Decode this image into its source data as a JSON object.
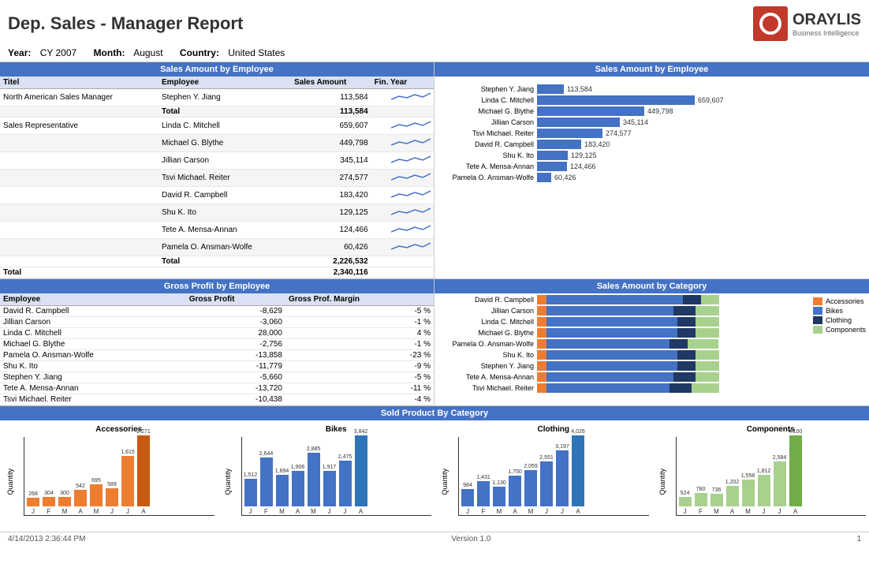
{
  "header": {
    "title": "Dep. Sales - Manager Report",
    "year_label": "Year:",
    "year_val": "CY 2007",
    "month_label": "Month:",
    "month_val": "August",
    "country_label": "Country:",
    "country_val": "United States"
  },
  "logo": {
    "name": "ORAYLIS",
    "sub": "Business Intelligence"
  },
  "sales_by_employee_table": {
    "title": "Sales Amount by Employee",
    "cols": [
      "Titel",
      "Employee",
      "Sales Amount",
      "Fin. Year"
    ],
    "rows": [
      {
        "titel": "North American Sales Manager",
        "employee": "Stephen Y. Jiang",
        "amount": "113,584",
        "fin_year": "~"
      },
      {
        "titel": "",
        "employee": "Total",
        "amount": "113,584",
        "fin_year": ""
      },
      {
        "titel": "Sales Representative",
        "employee": "Linda C. Mitchell",
        "amount": "659,607",
        "fin_year": "~"
      },
      {
        "titel": "",
        "employee": "Michael G. Blythe",
        "amount": "449,798",
        "fin_year": "~"
      },
      {
        "titel": "",
        "employee": "Jillian Carson",
        "amount": "345,114",
        "fin_year": "~"
      },
      {
        "titel": "",
        "employee": "Tsvi Michael. Reiter",
        "amount": "274,577",
        "fin_year": "~"
      },
      {
        "titel": "",
        "employee": "David R. Campbell",
        "amount": "183,420",
        "fin_year": "~"
      },
      {
        "titel": "",
        "employee": "Shu K. Ito",
        "amount": "129,125",
        "fin_year": "~"
      },
      {
        "titel": "",
        "employee": "Tete A. Mensa-Annan",
        "amount": "124,466",
        "fin_year": "~"
      },
      {
        "titel": "",
        "employee": "Pamela O. Ansman-Wolfe",
        "amount": "60,426",
        "fin_year": "~"
      },
      {
        "titel": "",
        "employee": "Total",
        "amount": "2,226,532",
        "fin_year": ""
      },
      {
        "titel": "Total",
        "employee": "",
        "amount": "2,340,116",
        "fin_year": ""
      }
    ]
  },
  "sales_bar_chart": {
    "title": "Sales Amount by Employee",
    "bars": [
      {
        "label": "Stephen Y. Jiang",
        "value": 113584,
        "display": "113,584"
      },
      {
        "label": "Linda C. Mitchell",
        "value": 659607,
        "display": "659,607"
      },
      {
        "label": "Michael G. Blythe",
        "value": 449798,
        "display": "449,798"
      },
      {
        "label": "Jillian Carson",
        "value": 345114,
        "display": "345,114"
      },
      {
        "label": "Tsvi Michael. Reiter",
        "value": 274577,
        "display": "274,577"
      },
      {
        "label": "David R. Campbell",
        "value": 183420,
        "display": "183,420"
      },
      {
        "label": "Shu K. Ito",
        "value": 129125,
        "display": "129,125"
      },
      {
        "label": "Tete A. Mensa-Annan",
        "value": 124466,
        "display": "124,466"
      },
      {
        "label": "Pamela O. Ansman-Wolfe",
        "value": 60426,
        "display": "60,426"
      }
    ],
    "max": 659607
  },
  "gross_profit_table": {
    "title": "Gross Profit by Employee",
    "cols": [
      "Employee",
      "Gross Profit",
      "Gross Prof. Margin"
    ],
    "rows": [
      {
        "employee": "David R. Campbell",
        "profit": "-8,629",
        "margin": "-5 %"
      },
      {
        "employee": "Jillian Carson",
        "profit": "-3,060",
        "margin": "-1 %"
      },
      {
        "employee": "Linda C. Mitchell",
        "profit": "28,000",
        "margin": "4 %"
      },
      {
        "employee": "Michael G. Blythe",
        "profit": "-2,756",
        "margin": "-1 %"
      },
      {
        "employee": "Pamela O. Ansman-Wolfe",
        "profit": "-13,858",
        "margin": "-23 %"
      },
      {
        "employee": "Shu K. Ito",
        "profit": "-11,779",
        "margin": "-9 %"
      },
      {
        "employee": "Stephen Y. Jiang",
        "profit": "-5,660",
        "margin": "-5 %"
      },
      {
        "employee": "Tete A. Mensa-Annan",
        "profit": "-13,720",
        "margin": "-11 %"
      },
      {
        "employee": "Tsvi Michael. Reiter",
        "profit": "-10,438",
        "margin": "-4 %"
      }
    ]
  },
  "sales_by_category_chart": {
    "title": "Sales Amount by Category",
    "legend": [
      "Accessories",
      "Bikes",
      "Clothing",
      "Components"
    ],
    "bars": [
      {
        "label": "David R. Campbell",
        "accessories": 5,
        "bikes": 75,
        "clothing": 10,
        "components": 10
      },
      {
        "label": "Jillian Carson",
        "accessories": 5,
        "bikes": 70,
        "clothing": 12,
        "components": 13
      },
      {
        "label": "Linda C. Mitchell",
        "accessories": 5,
        "bikes": 72,
        "clothing": 10,
        "components": 13
      },
      {
        "label": "Michael G. Blythe",
        "accessories": 5,
        "bikes": 72,
        "clothing": 10,
        "components": 13
      },
      {
        "label": "Pamela O. Ansman-Wolfe",
        "accessories": 5,
        "bikes": 68,
        "clothing": 10,
        "components": 17
      },
      {
        "label": "Shu K. Ito",
        "accessories": 5,
        "bikes": 72,
        "clothing": 10,
        "components": 13
      },
      {
        "label": "Stephen Y. Jiang",
        "accessories": 5,
        "bikes": 72,
        "clothing": 10,
        "components": 13
      },
      {
        "label": "Tete A. Mensa-Annan",
        "accessories": 5,
        "bikes": 70,
        "clothing": 12,
        "components": 13
      },
      {
        "label": "Tsvi Michael. Reiter",
        "accessories": 5,
        "bikes": 68,
        "clothing": 12,
        "components": 15
      }
    ]
  },
  "sold_by_category": {
    "title": "Sold Product By Category",
    "qty_label": "Quantity",
    "categories": [
      {
        "name": "Accessories",
        "color": "#ED7D31",
        "months": [
          "J",
          "F",
          "M",
          "A",
          "M",
          "J",
          "J",
          "A"
        ],
        "values": [
          268,
          304,
          300,
          542,
          695,
          589,
          1615,
          2271
        ]
      },
      {
        "name": "Bikes",
        "color": "#4472C4",
        "months": [
          "J",
          "F",
          "M",
          "A",
          "M",
          "J",
          "J",
          "A"
        ],
        "values": [
          1512,
          2644,
          1694,
          1906,
          2885,
          1917,
          2475,
          3842
        ]
      },
      {
        "name": "Clothing",
        "color": "#4472C4",
        "months": [
          "J",
          "F",
          "M",
          "A",
          "M",
          "J",
          "J",
          "A"
        ],
        "values": [
          984,
          1431,
          1130,
          1750,
          2059,
          2551,
          3197,
          4026
        ]
      },
      {
        "name": "Components",
        "color": "#A9D18E",
        "months": [
          "J",
          "F",
          "M",
          "A",
          "M",
          "J",
          "J",
          "A"
        ],
        "values": [
          524,
          780,
          736,
          1202,
          1558,
          1812,
          2584,
          4100
        ]
      }
    ]
  },
  "footer": {
    "datetime": "4/14/2013 2:36:44 PM",
    "version": "Version 1.0",
    "page": "1"
  }
}
